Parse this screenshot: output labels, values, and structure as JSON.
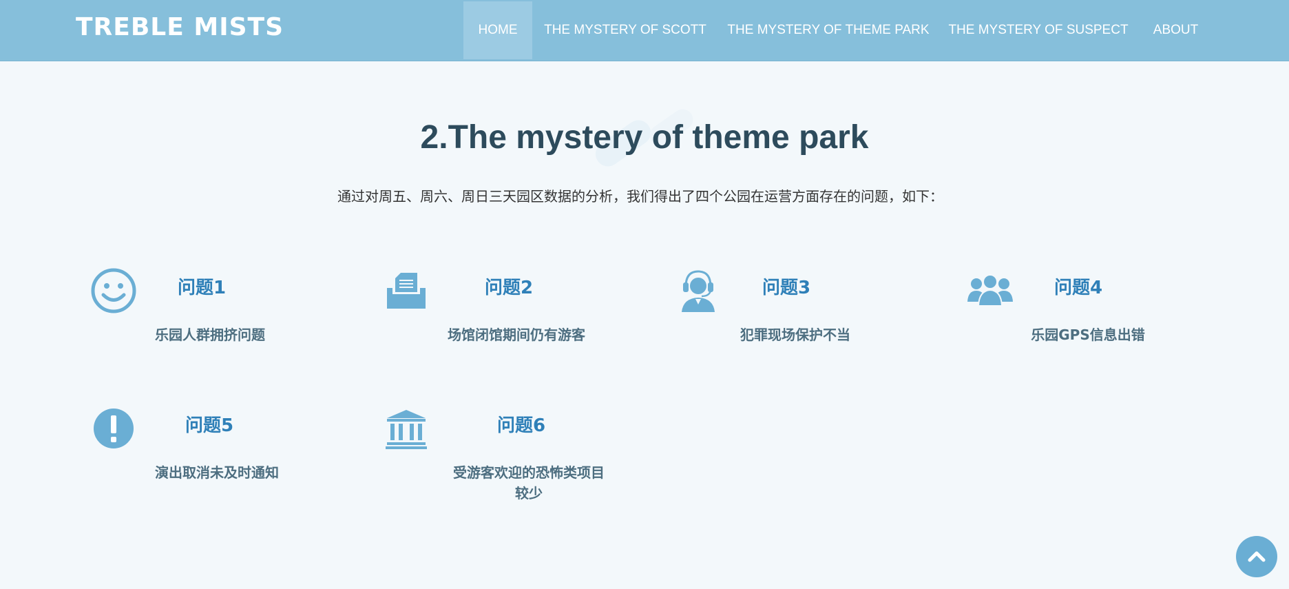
{
  "header": {
    "logo": "TREBLE MISTS",
    "menu": [
      {
        "label": "HOME",
        "active": true
      },
      {
        "label": "THE MYSTERY OF SCOTT",
        "active": false
      },
      {
        "label": "THE MYSTERY OF THEME PARK",
        "active": false
      },
      {
        "label": "THE MYSTERY OF SUSPECT",
        "active": false
      },
      {
        "label": "ABOUT",
        "active": false
      }
    ]
  },
  "main": {
    "title": "2.The mystery of theme park",
    "intro": "通过对周五、周六、周日三天园区数据的分析，我们得出了四个公园在运营方面存在的问题，如下：",
    "problems": [
      {
        "title": "问题1",
        "desc": "乐园人群拥挤问题",
        "icon": "smiley-icon"
      },
      {
        "title": "问题2",
        "desc": "场馆闭馆期间仍有游客",
        "icon": "document-tray-icon"
      },
      {
        "title": "问题3",
        "desc": "犯罪现场保护不当",
        "icon": "headset-agent-icon"
      },
      {
        "title": "问题4",
        "desc": "乐园GPS信息出错",
        "icon": "user-group-icon"
      },
      {
        "title": "问题5",
        "desc": "演出取消未及时通知",
        "icon": "exclamation-icon"
      },
      {
        "title": "问题6",
        "desc": "受游客欢迎的恐怖类项目较少",
        "icon": "bank-building-icon"
      }
    ]
  },
  "colors": {
    "nav_bg": "#86bfdb",
    "icon": "#6aaed4",
    "title": "#2d4b5c",
    "problem_title": "#2f80b8"
  },
  "back_to_top": {
    "icon": "chevron-up-icon"
  }
}
